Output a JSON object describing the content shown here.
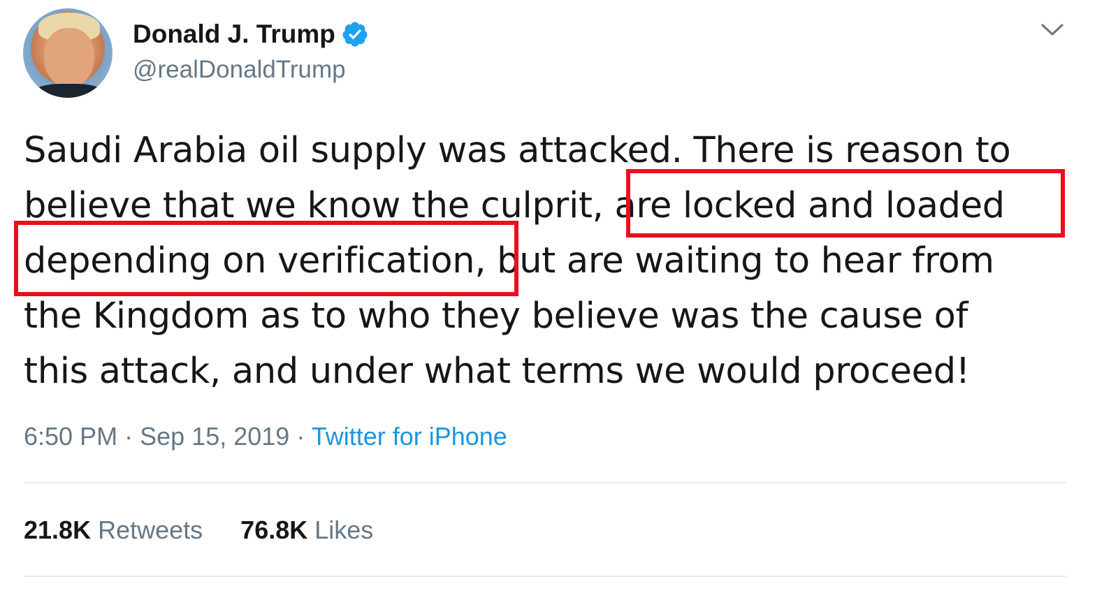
{
  "author": {
    "display_name": "Donald J. Trump",
    "handle": "@realDonaldTrump",
    "verified": true
  },
  "tweet": {
    "lines": [
      "Saudi Arabia oil supply was attacked. There is reason to",
      "believe that we know the culprit, are locked and loaded",
      "depending on verification, but are waiting to hear from",
      "the Kingdom as to who they believe was the cause of",
      "this attack, and under what terms we would proceed!"
    ],
    "line2_plain": "believe that we know the culprit,",
    "line2_highlight": "are locked and loaded",
    "line3_highlight": "depending on verification,",
    "line3_plain": "but are waiting to hear from"
  },
  "meta": {
    "time": "6:50 PM",
    "separator": "·",
    "date": "Sep 15, 2019",
    "source": "Twitter for iPhone"
  },
  "stats": {
    "retweets_count": "21.8K",
    "retweets_label": "Retweets",
    "likes_count": "76.8K",
    "likes_label": "Likes"
  },
  "colors": {
    "text": "#14171a",
    "secondary": "#657786",
    "link": "#1b95e0",
    "verified": "#1da1f2",
    "highlight_box": "#e8101c",
    "divider": "#e6ecf0"
  },
  "icons": {
    "verified": "verified-badge-icon",
    "caret": "chevron-down-icon"
  }
}
